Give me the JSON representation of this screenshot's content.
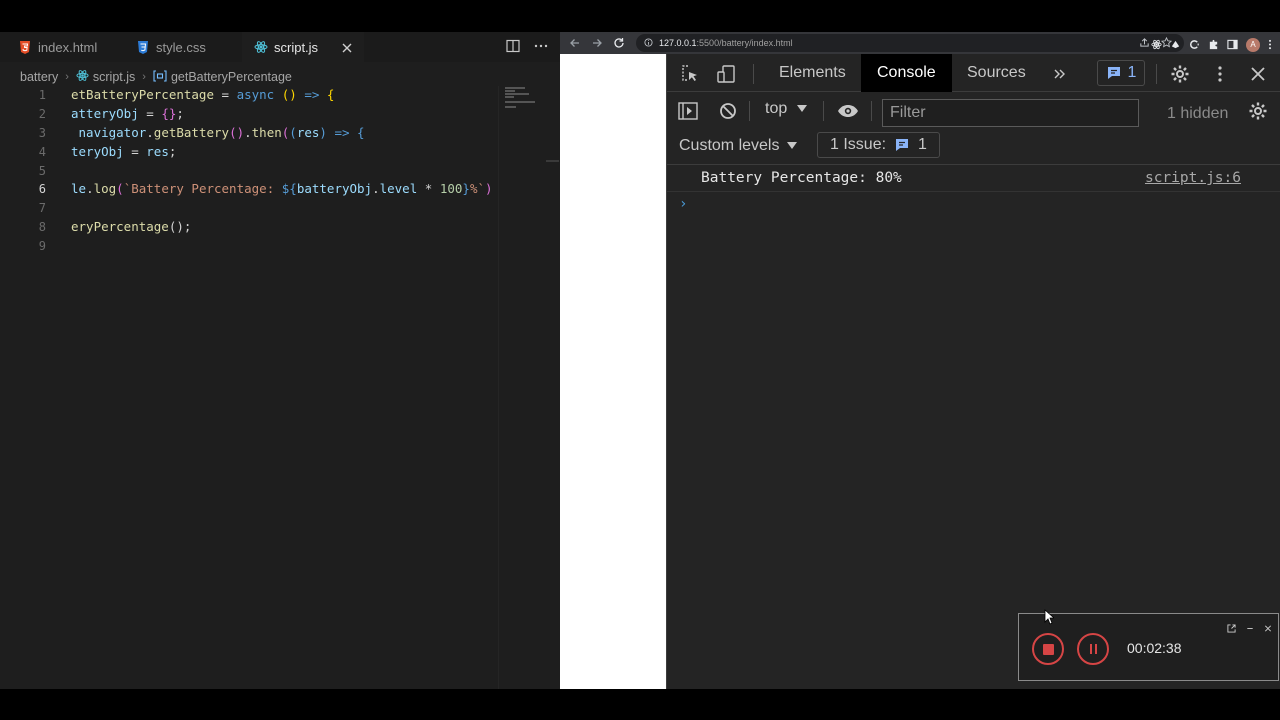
{
  "editor": {
    "tabs": [
      {
        "label": "index.html",
        "icon": "html5-icon"
      },
      {
        "label": "style.css",
        "icon": "css3-icon"
      },
      {
        "label": "script.js",
        "icon": "react-icon",
        "active": true
      }
    ],
    "breadcrumb": {
      "folder": "battery",
      "file": "script.js",
      "symbol": "getBatteryPercentage"
    },
    "line_numbers": [
      "1",
      "2",
      "3",
      "4",
      "5",
      "6",
      "7",
      "8",
      "9"
    ],
    "current_line": "6",
    "code": {
      "l1_name": "etBatteryPercentage",
      "l1_eq": " = ",
      "l1_async": "async",
      "l1_params": " () ",
      "l1_arrow": "=>",
      "l1_brace": " {",
      "l2_name": "atteryObj",
      "l2_eq": " = ",
      "l2_obj": "{}",
      "l2_semi": ";",
      "l3_indent": " ",
      "l3_nav": "navigator",
      "l3_dot": ".",
      "l3_get": "getBattery",
      "l3_call": "()",
      "l3_dot2": ".",
      "l3_then": "then",
      "l3_open": "(",
      "l3_args_open": "(",
      "l3_res": "res",
      "l3_args_close": ")",
      "l3_arrow": " => ",
      "l3_brace": "{",
      "l4_name": "teryObj",
      "l4_eq": " = ",
      "l4_res": "res",
      "l4_semi": ";",
      "l6_obj": "le",
      "l6_dot": ".",
      "l6_log": "log",
      "l6_open": "(",
      "l6_str_start": "`Battery Percentage: ",
      "l6_ph_open": "${",
      "l6_var": "batteryObj",
      "l6_dot2": ".",
      "l6_level": "level",
      "l6_mul": " * ",
      "l6_num": "100",
      "l6_ph_close": "}",
      "l6_str_end": "%`",
      "l6_close": ")",
      "l8_call": "eryPercentage",
      "l8_rest": "();"
    }
  },
  "browser": {
    "url_host": "127.0.0.1",
    "url_path": ":5500/battery/index.html",
    "avatar_letter": "A"
  },
  "devtools": {
    "tabs": [
      "Elements",
      "Console",
      "Sources"
    ],
    "active_tab": "Console",
    "issue_badge_count": "1",
    "context": "top",
    "filter_placeholder": "Filter",
    "hidden_count": "1 hidden",
    "levels": "Custom levels",
    "issues_label": "1 Issue:",
    "issues_count": "1",
    "console": {
      "message": "Battery Percentage: 80%",
      "source": "script.js:6"
    },
    "prompt": "›"
  },
  "recorder": {
    "time": "00:02:38"
  },
  "colors": {
    "accent_blue": "#8ab4f8",
    "record_red": "#d64545",
    "editor_bg": "#1e1e1e"
  }
}
